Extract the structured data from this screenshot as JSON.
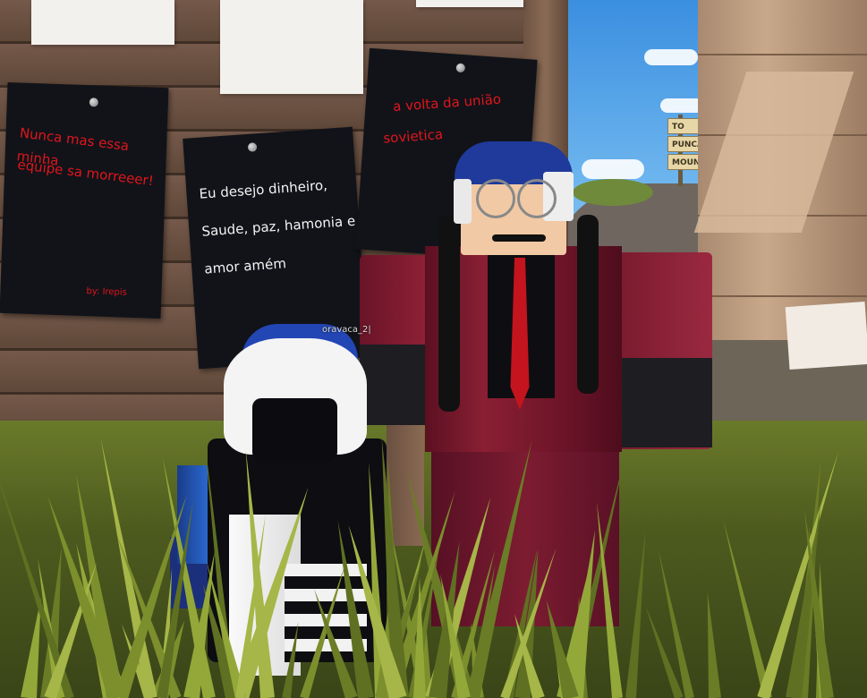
{
  "signs": [
    "TO",
    "PUNCAK",
    "MOUNT"
  ],
  "notes": {
    "note1": {
      "lines": [
        "Nunca mas essa minha",
        "equipe sa morreeer!"
      ],
      "signature": "by: Irepis",
      "text_color": "#e0161b"
    },
    "note2": {
      "lines": [
        "Eu desejo dinheiro,",
        "Saude, paz, hamonia e",
        "amor amém"
      ],
      "text_color": "#f4f4f4"
    },
    "note3": {
      "lines": [
        "a volta da união",
        "sovietica"
      ],
      "text_color": "#e0161b"
    }
  },
  "player_tag": "oravaca_2|",
  "colors": {
    "suit": "#8a1f33",
    "tie": "#c4141e",
    "cap": "#1f3a9a",
    "note_bg": "#111319"
  }
}
